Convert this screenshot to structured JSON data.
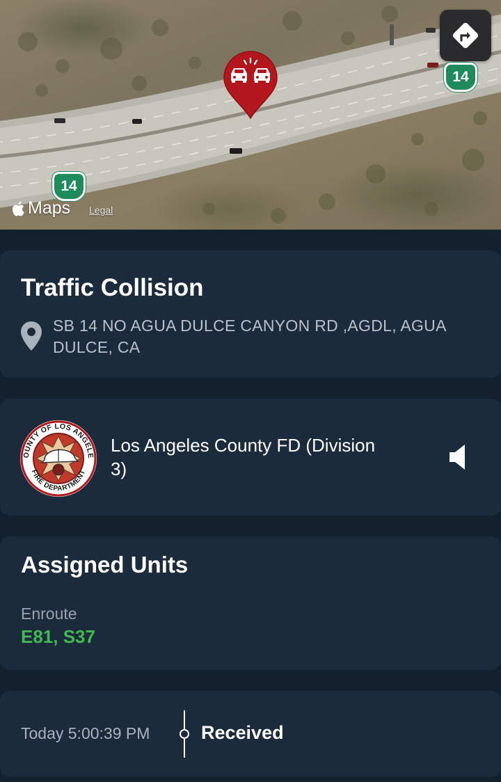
{
  "map": {
    "route_shield_label": "14",
    "maps_brand": "Maps",
    "legal_link": "Legal"
  },
  "incident": {
    "title": "Traffic Collision",
    "address": "SB 14 NO AGUA DULCE CANYON RD ,AGDL, AGUA DULCE, CA"
  },
  "agency": {
    "name": "Los Angeles County FD (Division 3)",
    "logo_top_text": "COUNTY OF LOS ANGELES",
    "logo_bottom_text": "FIRE DEPARTMENT"
  },
  "units": {
    "title": "Assigned Units",
    "status": "Enroute",
    "list": "E81, S37"
  },
  "timeline": {
    "time": "Today 5:00:39 PM",
    "status": "Received"
  },
  "colors": {
    "background": "#13202e",
    "card": "#1c2b3c",
    "pin_red": "#b3161c",
    "route_green": "#1f8a5b",
    "units_green": "#3fb950"
  },
  "icons": {
    "directions": "directions-icon",
    "incident_pin": "collision-pin-icon",
    "location": "location-pin-icon",
    "speaker": "speaker-icon"
  }
}
